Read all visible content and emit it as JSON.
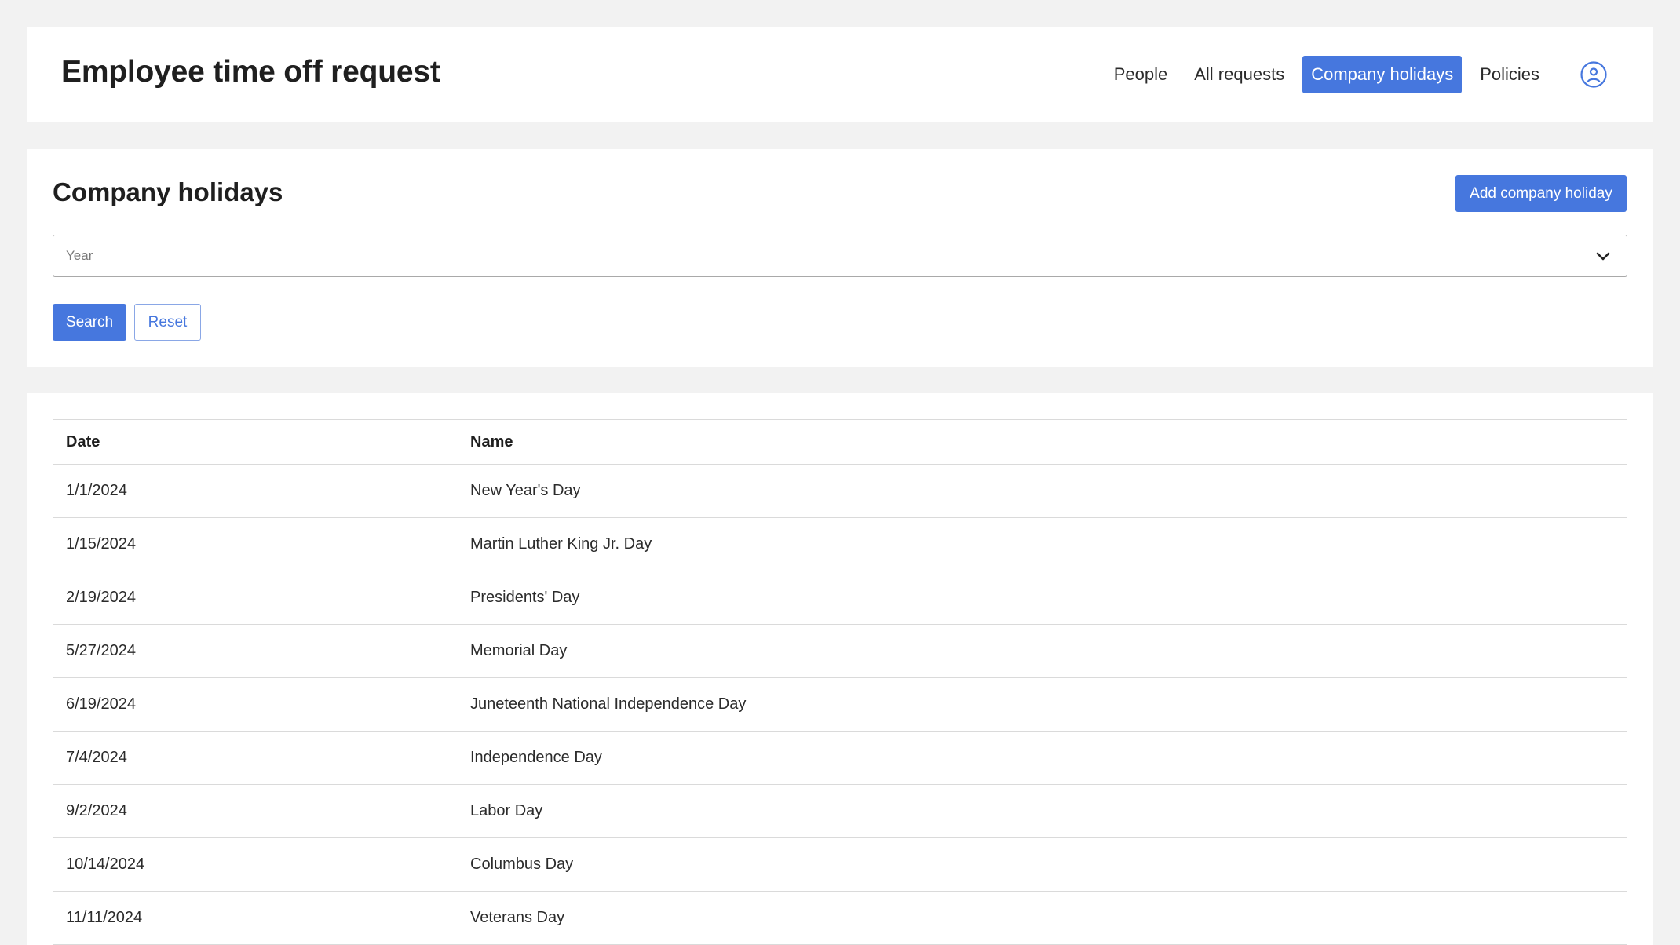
{
  "header": {
    "title": "Employee time off request",
    "nav": [
      {
        "label": "People",
        "active": false
      },
      {
        "label": "All requests",
        "active": false
      },
      {
        "label": "Company holidays",
        "active": true
      },
      {
        "label": "Policies",
        "active": false
      }
    ],
    "user_icon": "user-circle-icon"
  },
  "filters": {
    "section_title": "Company holidays",
    "add_button_label": "Add company holiday",
    "year_placeholder": "Year",
    "dropdown_icon": "chevron-down-icon",
    "search_label": "Search",
    "reset_label": "Reset"
  },
  "table": {
    "columns": [
      "Date",
      "Name"
    ],
    "rows": [
      {
        "date": "1/1/2024",
        "name": "New Year's Day"
      },
      {
        "date": "1/15/2024",
        "name": "Martin Luther King Jr. Day"
      },
      {
        "date": "2/19/2024",
        "name": "Presidents' Day"
      },
      {
        "date": "5/27/2024",
        "name": "Memorial Day"
      },
      {
        "date": "6/19/2024",
        "name": "Juneteenth National Independence Day"
      },
      {
        "date": "7/4/2024",
        "name": "Independence Day"
      },
      {
        "date": "9/2/2024",
        "name": "Labor Day"
      },
      {
        "date": "10/14/2024",
        "name": "Columbus Day"
      },
      {
        "date": "11/11/2024",
        "name": "Veterans Day"
      }
    ]
  },
  "colors": {
    "accent": "#4677de",
    "page_background": "#f2f2f2",
    "card_background": "#ffffff"
  }
}
